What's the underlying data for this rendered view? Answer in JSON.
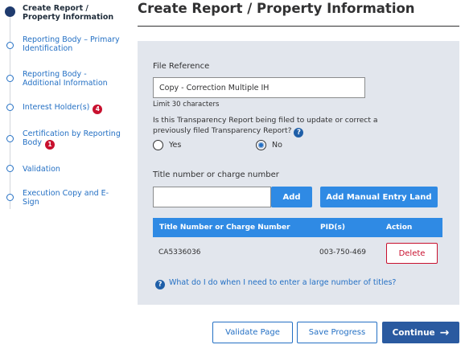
{
  "sidebar": {
    "steps": [
      {
        "label": "Create Report / Property Information",
        "badge": ""
      },
      {
        "label": "Reporting Body – Primary Identification",
        "badge": ""
      },
      {
        "label": "Reporting Body - Additional Information",
        "badge": ""
      },
      {
        "label": "Interest Holder(s)",
        "badge": "4"
      },
      {
        "label": "Certification by Reporting Body",
        "badge": "1"
      },
      {
        "label": "Validation",
        "badge": ""
      },
      {
        "label": "Execution Copy and E-Sign",
        "badge": ""
      }
    ]
  },
  "header": {
    "title": "Create Report / Property Information"
  },
  "form": {
    "file_reference_label": "File Reference",
    "file_reference_value": "Copy - Correction Multiple IH",
    "file_reference_hint": "Limit 30 characters",
    "question": "Is this Transparency Report being filed to update or correct a previously filed Transparency Report?",
    "help_glyph": "?",
    "radio_yes": "Yes",
    "radio_no": "No",
    "selected_radio": "No",
    "title_label": "Title number or charge number",
    "title_input_value": "",
    "add_label": "Add",
    "manual_entry_label": "Add Manual Entry Land"
  },
  "table": {
    "headers": [
      "Title Number or Charge Number",
      "PID(s)",
      "Action"
    ],
    "rows": [
      {
        "title": "CA5336036",
        "pid": "003-750-469",
        "action": "Delete"
      }
    ]
  },
  "help_link": "What do I do when I need to enter a large number of titles?",
  "footer": {
    "validate_label": "Validate Page",
    "save_label": "Save Progress",
    "continue_label": "Continue",
    "continue_arrow": "→"
  },
  "colors": {
    "accent": "#2f8ae4",
    "primary_dark": "#2a5aa0",
    "link": "#2470c4",
    "danger": "#c8102e",
    "panel_bg": "#e2e6ed"
  }
}
